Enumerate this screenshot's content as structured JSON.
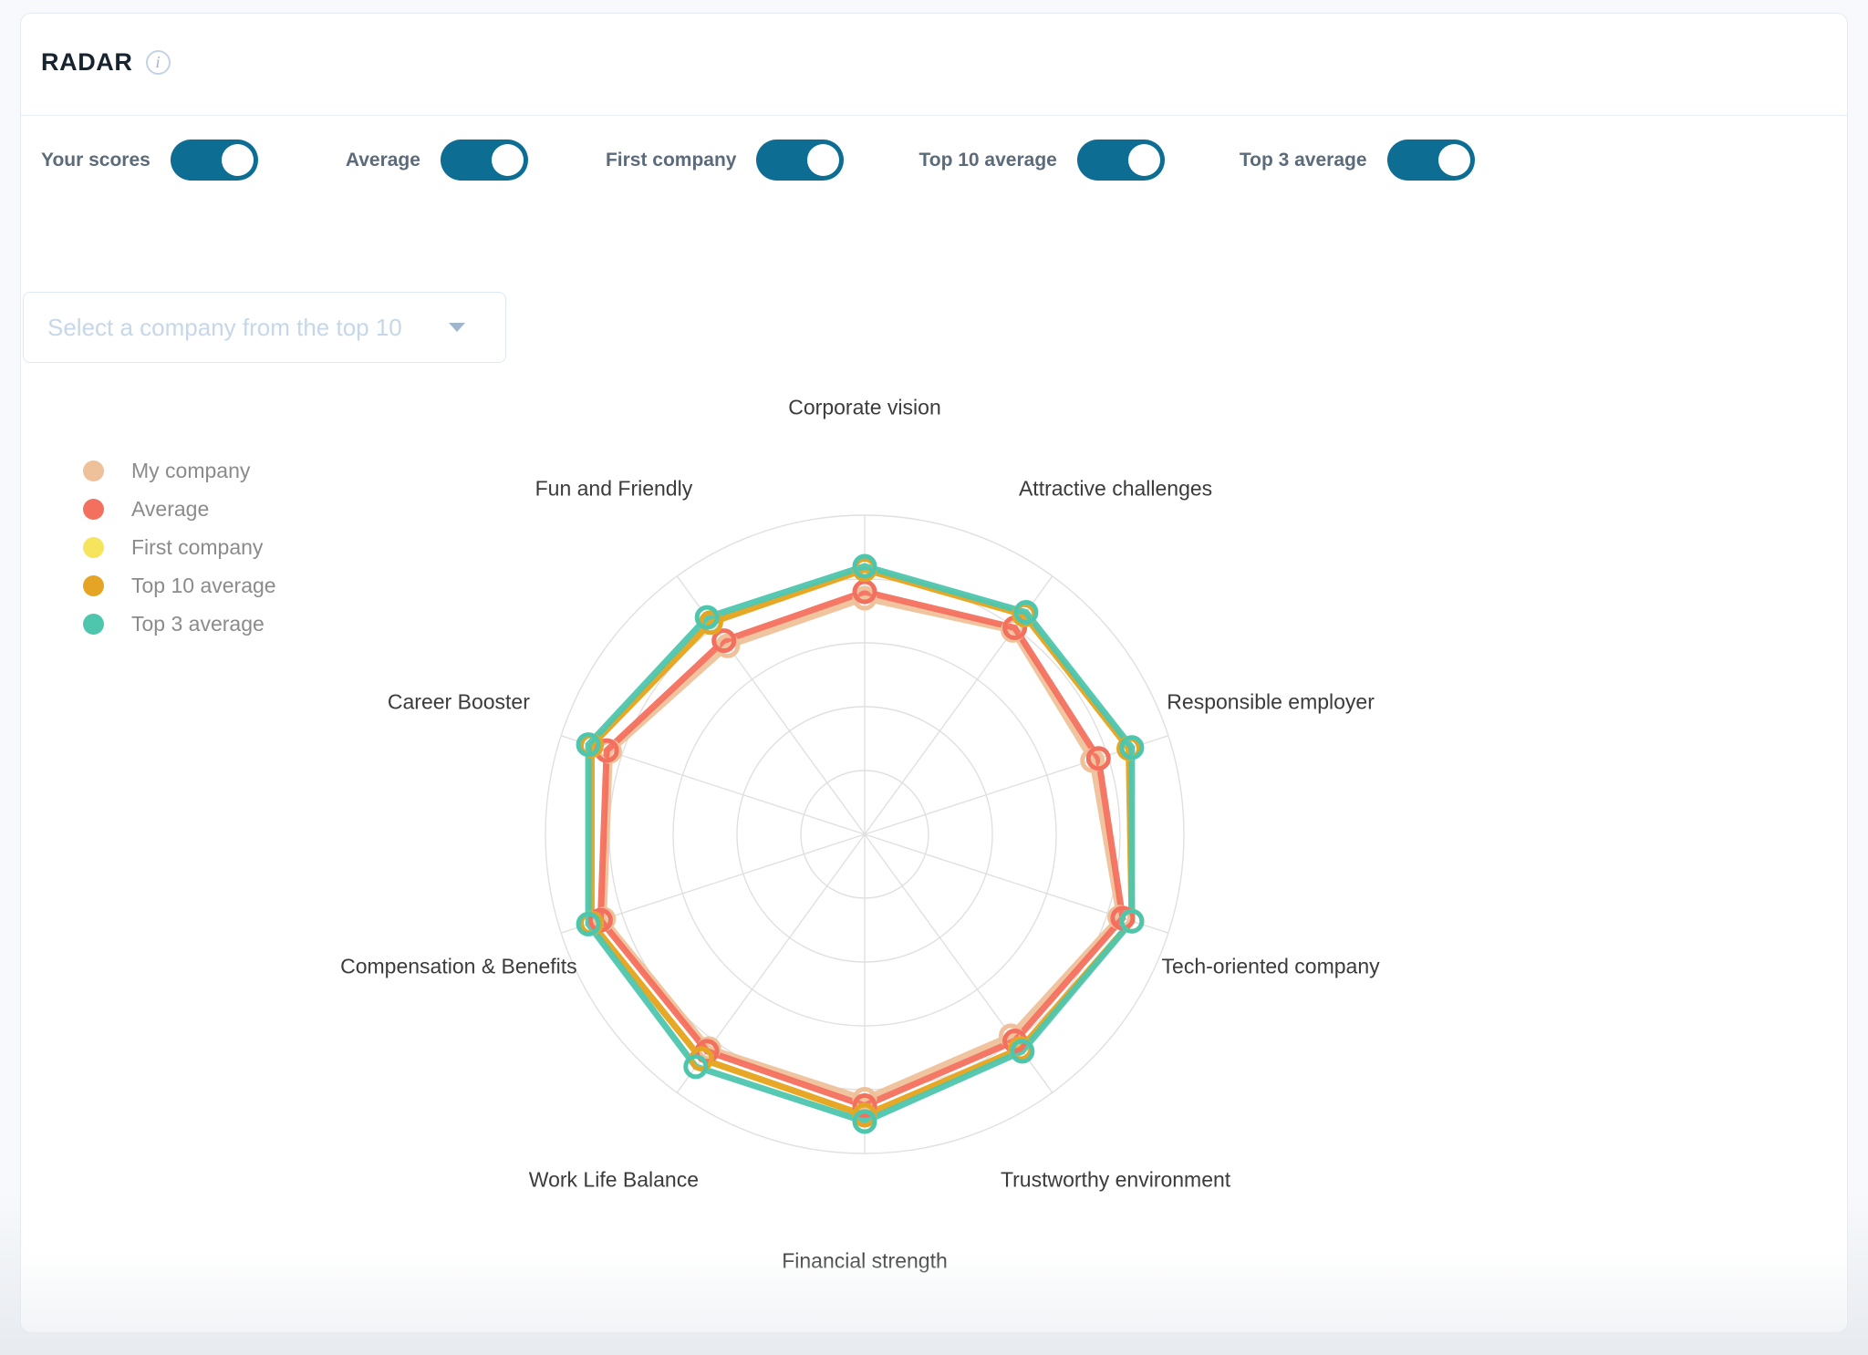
{
  "header": {
    "title": "RADAR",
    "info_icon": "info-icon"
  },
  "toggles": [
    {
      "label": "Your scores",
      "on": true
    },
    {
      "label": "Average",
      "on": true
    },
    {
      "label": "First company",
      "on": true
    },
    {
      "label": "Top 10 average",
      "on": true
    },
    {
      "label": "Top 3 average",
      "on": true
    }
  ],
  "company_select": {
    "placeholder": "Select a company from the top 10",
    "value": "",
    "caret_icon": "chevron-down-icon"
  },
  "colors": {
    "toggle_on": "#0d6d92",
    "my_company": "#eec19a",
    "average": "#f4705e",
    "first_company": "#f6e45c",
    "top10_average": "#e5a423",
    "top3_average": "#4ec6ae",
    "grid": "#e0e0e0",
    "label_text": "#3b3b3b"
  },
  "chart_data": {
    "type": "radar",
    "title": "",
    "categories": [
      "Corporate vision",
      "Attractive challenges",
      "Responsible employer",
      "Tech-oriented company",
      "Trustworthy environment",
      "Financial strength",
      "Work Life Balance",
      "Compensation & Benefits",
      "Career Booster",
      "Fun and Friendly"
    ],
    "rmax": 100,
    "rings": 5,
    "grid": true,
    "legend_position": "left",
    "series": [
      {
        "name": "My company",
        "color": "#eec19a",
        "values": [
          74,
          79,
          75,
          84,
          78,
          83,
          83,
          86,
          84,
          73
        ]
      },
      {
        "name": "Average",
        "color": "#f4705e",
        "values": [
          76,
          80,
          77,
          85,
          80,
          85,
          84,
          87,
          85,
          75
        ]
      },
      {
        "name": "First company",
        "color": "#f6e45c",
        "values": [
          83,
          85,
          87,
          88,
          83,
          88,
          87,
          90,
          90,
          82
        ]
      },
      {
        "name": "Top 10 average",
        "color": "#e5a423",
        "values": [
          83,
          85,
          87,
          88,
          83,
          88,
          87,
          90,
          90,
          82
        ]
      },
      {
        "name": "Top 3 average",
        "color": "#4ec6ae",
        "values": [
          84,
          86,
          88,
          88,
          84,
          90,
          90,
          91,
          91,
          84
        ]
      }
    ]
  },
  "legend": [
    {
      "label": "My company"
    },
    {
      "label": "Average"
    },
    {
      "label": "First company"
    },
    {
      "label": "Top 10 average"
    },
    {
      "label": "Top 3 average"
    }
  ]
}
